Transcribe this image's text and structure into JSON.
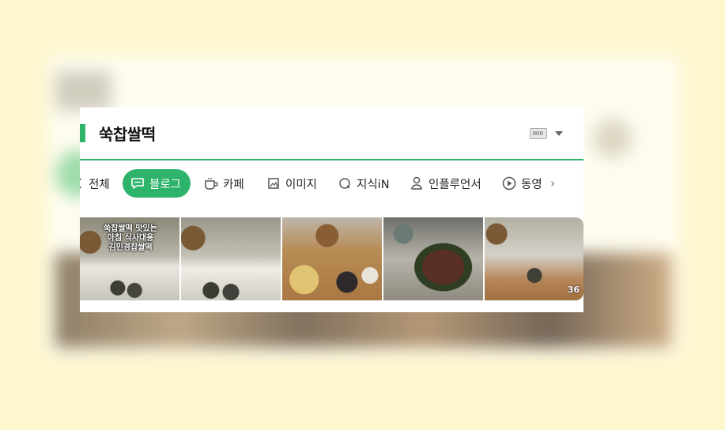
{
  "search": {
    "query": "쑥찹쌀떡"
  },
  "tabs": [
    {
      "label": "전체",
      "icon": "all-icon",
      "active": false
    },
    {
      "label": "블로그",
      "icon": "blog-icon",
      "active": true
    },
    {
      "label": "카페",
      "icon": "cafe-cup-icon",
      "active": false
    },
    {
      "label": "이미지",
      "icon": "image-icon",
      "active": false
    },
    {
      "label": "지식iN",
      "icon": "kin-icon",
      "active": false
    },
    {
      "label": "인플루언서",
      "icon": "person-icon",
      "active": false
    },
    {
      "label": "동영",
      "icon": "play-icon",
      "active": false
    }
  ],
  "photos": {
    "first_overlay": [
      "쑥찹쌀떡 맛있는",
      "아침 식사대용",
      "김민경찹쌀떡"
    ],
    "last_badge": "36"
  },
  "colors": {
    "accent": "#2db36a",
    "background": "#fdf6cf"
  }
}
